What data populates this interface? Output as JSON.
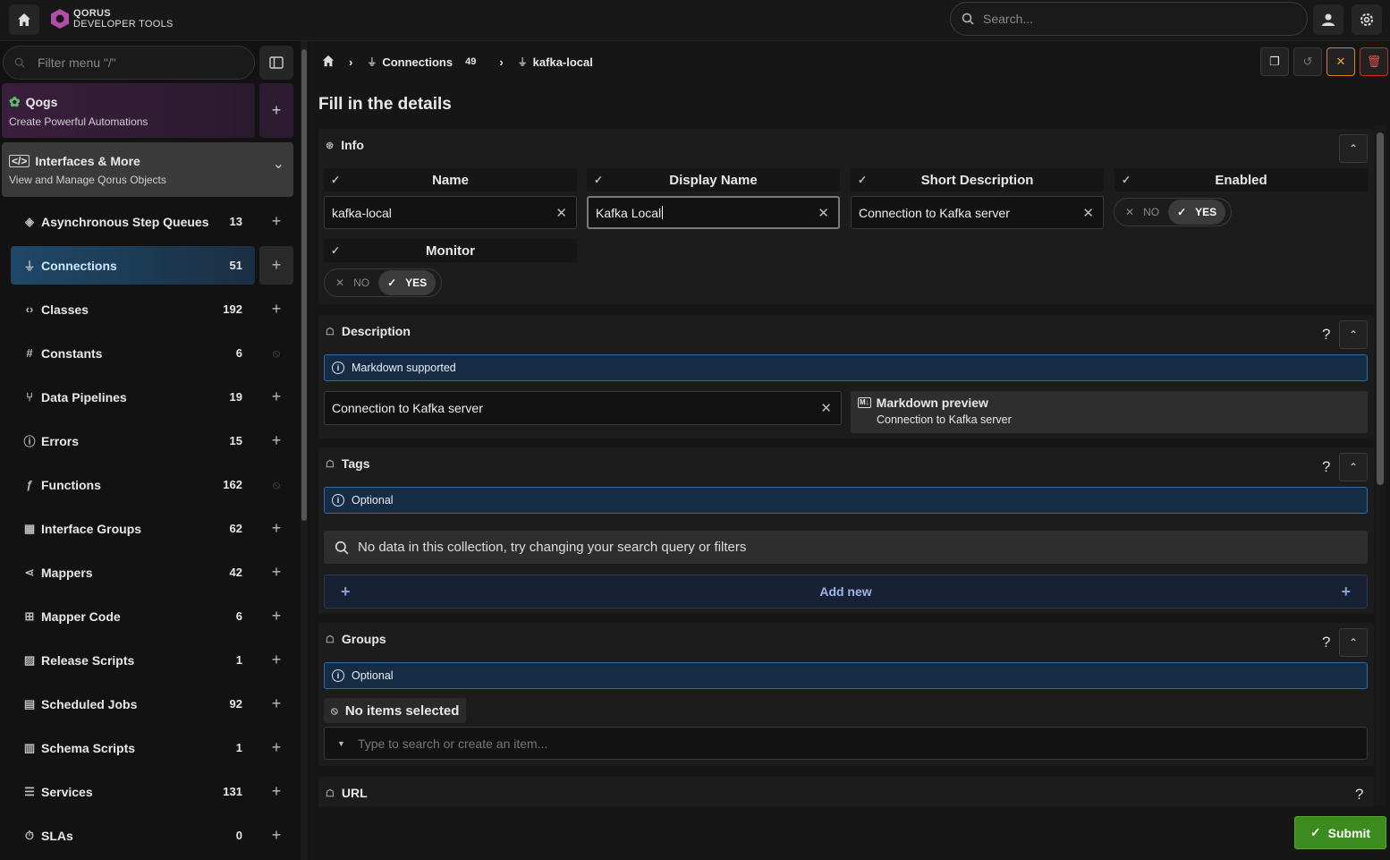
{
  "app": {
    "logo_line1": "QORUS",
    "logo_line2": "DEVELOPER TOOLS",
    "search_placeholder": "Search..."
  },
  "sidebar": {
    "filter_placeholder": "Filter menu \"/\"",
    "qogs": {
      "title": "Qogs",
      "subtitle": "Create Powerful Automations"
    },
    "interfaces": {
      "title": "Interfaces & More",
      "subtitle": "View and Manage Qorus Objects"
    },
    "items": [
      {
        "label": "Asynchronous Step Queues",
        "count": "13",
        "icon": "layers-icon",
        "action": "add"
      },
      {
        "label": "Connections",
        "count": "51",
        "icon": "plug-icon",
        "action": "add",
        "active": true
      },
      {
        "label": "Classes",
        "count": "192",
        "icon": "code-icon",
        "action": "add"
      },
      {
        "label": "Constants",
        "count": "6",
        "icon": "hash-icon",
        "action": "disabled"
      },
      {
        "label": "Data Pipelines",
        "count": "19",
        "icon": "pipeline-icon",
        "action": "add"
      },
      {
        "label": "Errors",
        "count": "15",
        "icon": "error-icon",
        "action": "add"
      },
      {
        "label": "Functions",
        "count": "162",
        "icon": "function-icon",
        "action": "disabled"
      },
      {
        "label": "Interface Groups",
        "count": "62",
        "icon": "grid-icon",
        "action": "add"
      },
      {
        "label": "Mappers",
        "count": "42",
        "icon": "share-icon",
        "action": "add"
      },
      {
        "label": "Mapper Code",
        "count": "6",
        "icon": "code-grid-icon",
        "action": "add"
      },
      {
        "label": "Release Scripts",
        "count": "1",
        "icon": "script-icon",
        "action": "add"
      },
      {
        "label": "Scheduled Jobs",
        "count": "92",
        "icon": "calendar-icon",
        "action": "add"
      },
      {
        "label": "Schema Scripts",
        "count": "1",
        "icon": "schema-icon",
        "action": "add"
      },
      {
        "label": "Services",
        "count": "131",
        "icon": "services-icon",
        "action": "add"
      },
      {
        "label": "SLAs",
        "count": "0",
        "icon": "stopwatch-icon",
        "action": "add"
      }
    ]
  },
  "breadcrumb": {
    "items": [
      {
        "label": "Connections",
        "count": "49"
      },
      {
        "label": "kafka-local"
      }
    ]
  },
  "page": {
    "title": "Fill in the details"
  },
  "info": {
    "title": "Info",
    "fields": {
      "name": {
        "label": "Name",
        "value": "kafka-local"
      },
      "display_name": {
        "label": "Display Name",
        "value": "Kafka Local"
      },
      "short_description": {
        "label": "Short Description",
        "value": "Connection to Kafka server"
      },
      "enabled": {
        "label": "Enabled",
        "no": "NO",
        "yes": "YES",
        "value": "YES"
      },
      "monitor": {
        "label": "Monitor",
        "no": "NO",
        "yes": "YES",
        "value": "YES"
      }
    }
  },
  "description": {
    "title": "Description",
    "help": "?",
    "info": "Markdown supported",
    "value": "Connection to Kafka server",
    "preview_title": "Markdown preview",
    "preview_text": "Connection to Kafka server"
  },
  "tags": {
    "title": "Tags",
    "help": "?",
    "info": "Optional",
    "empty": "No data in this collection, try changing your search query or filters",
    "add_new": "Add new"
  },
  "groups": {
    "title": "Groups",
    "help": "?",
    "info": "Optional",
    "no_items": "No items selected",
    "placeholder": "Type to search or create an item..."
  },
  "url": {
    "title": "URL",
    "help": "?"
  },
  "submit": {
    "label": "Submit"
  },
  "colors": {
    "accent_blue": "#2f6ea8",
    "submit_green": "#3b8b1e",
    "delete_red": "#c23030",
    "cancel_orange": "#d9822b"
  }
}
